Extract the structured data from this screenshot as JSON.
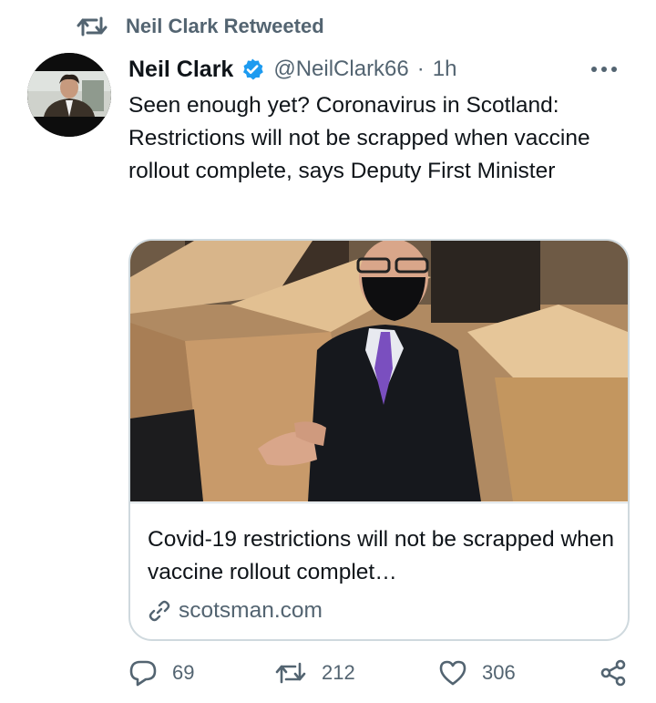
{
  "retweet": {
    "label": "Neil Clark Retweeted",
    "icon": "retweet-icon"
  },
  "author": {
    "name": "Neil Clark",
    "handle": "@NeilClark66",
    "separator": "·",
    "time": "1h",
    "verified": true
  },
  "tweet": {
    "text": "Seen enough yet? Coronavirus in Scotland: Restrictions will not be scrapped when vaccine rollout complete, says Deputy First Minister"
  },
  "card": {
    "title": "Covid-19 restrictions will not be scrapped when vaccine rollout complet…",
    "domain": "scotsman.com"
  },
  "actions": {
    "replies": "69",
    "retweets": "212",
    "likes": "306"
  },
  "colors": {
    "accent": "#1d9bf0",
    "secondary_text": "#536471",
    "border": "#cfd9de"
  }
}
